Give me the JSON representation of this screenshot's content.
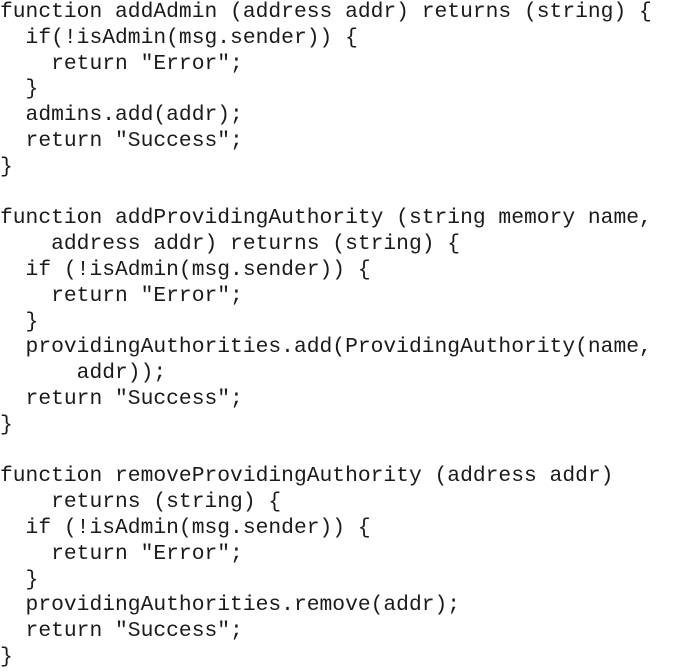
{
  "code_block": {
    "language": "solidity",
    "lines": [
      "function addAdmin (address addr) returns (string) {",
      "  if(!isAdmin(msg.sender)) {",
      "    return \"Error\";",
      "  }",
      "  admins.add(addr);",
      "  return \"Success\";",
      "}",
      "",
      "function addProvidingAuthority (string memory name,",
      "    address addr) returns (string) {",
      "  if (!isAdmin(msg.sender)) {",
      "    return \"Error\";",
      "  }",
      "  providingAuthorities.add(ProvidingAuthority(name,",
      "      addr));",
      "  return \"Success\";",
      "}",
      "",
      "function removeProvidingAuthority (address addr)",
      "    returns (string) {",
      "  if (!isAdmin(msg.sender)) {",
      "    return \"Error\";",
      "  }",
      "  providingAuthorities.remove(addr);",
      "  return \"Success\";",
      "}"
    ]
  }
}
